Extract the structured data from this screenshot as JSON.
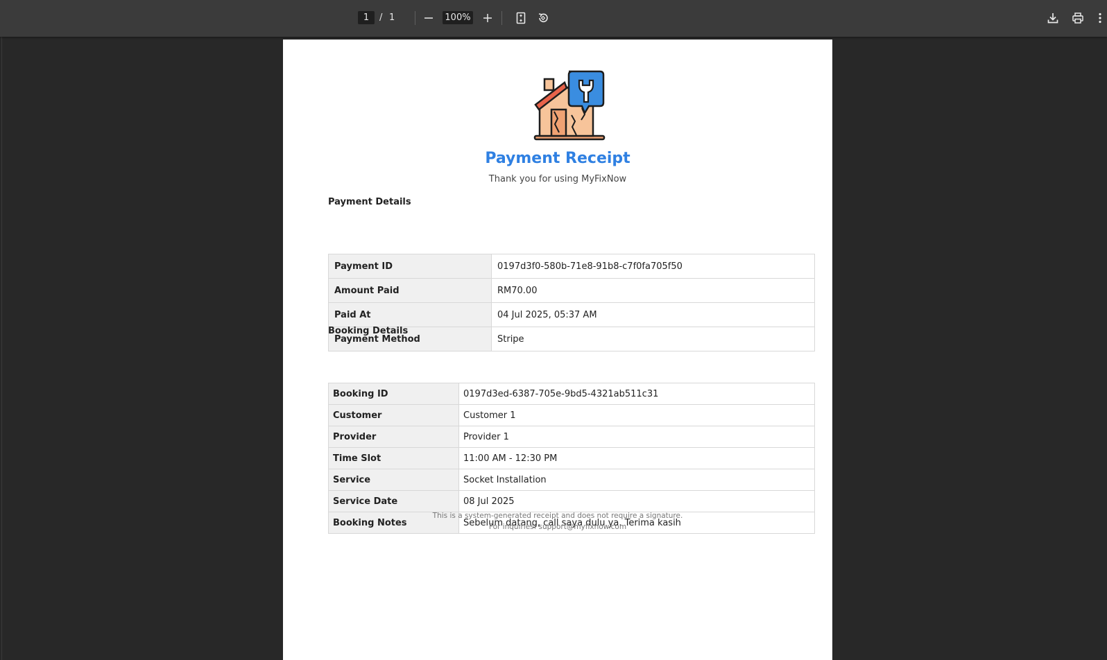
{
  "toolbar": {
    "current_page": "1",
    "separator": "/",
    "total_pages": "1",
    "zoom": "100%",
    "icons": [
      "minus-icon",
      "plus-icon",
      "fit-page-icon",
      "rotate-icon",
      "download-icon",
      "print-icon",
      "more-icon"
    ]
  },
  "receipt": {
    "logo_icon": "house-repair-wrench-icon",
    "title": "Payment Receipt",
    "subtitle": "Thank you for using MyFixNow",
    "accent_color": "#2f80e2",
    "payment_heading": "Payment Details",
    "payment_rows": [
      {
        "label": "Payment ID",
        "value": "0197d3f0-580b-71e8-91b8-c7f0fa705f50"
      },
      {
        "label": "Amount Paid",
        "value": "RM70.00"
      },
      {
        "label": "Paid At",
        "value": "04 Jul 2025, 05:37 AM"
      },
      {
        "label": "Payment Method",
        "value": "Stripe"
      }
    ],
    "booking_heading": "Booking Details",
    "booking_rows": [
      {
        "label": "Booking ID",
        "value": "0197d3ed-6387-705e-9bd5-4321ab511c31"
      },
      {
        "label": "Customer",
        "value": "Customer 1"
      },
      {
        "label": "Provider",
        "value": "Provider 1"
      },
      {
        "label": "Time Slot",
        "value": "11:00 AM - 12:30 PM"
      },
      {
        "label": "Service",
        "value": "Socket Installation"
      },
      {
        "label": "Service Date",
        "value": "08 Jul 2025"
      },
      {
        "label": "Booking Notes",
        "value": "Sebelum datang, call saya dulu ya. Terima kasih"
      }
    ],
    "footer_line1": "This is a system-generated receipt and does not require a signature.",
    "footer_line2": "For inquiries: support@myfixnow.com"
  }
}
